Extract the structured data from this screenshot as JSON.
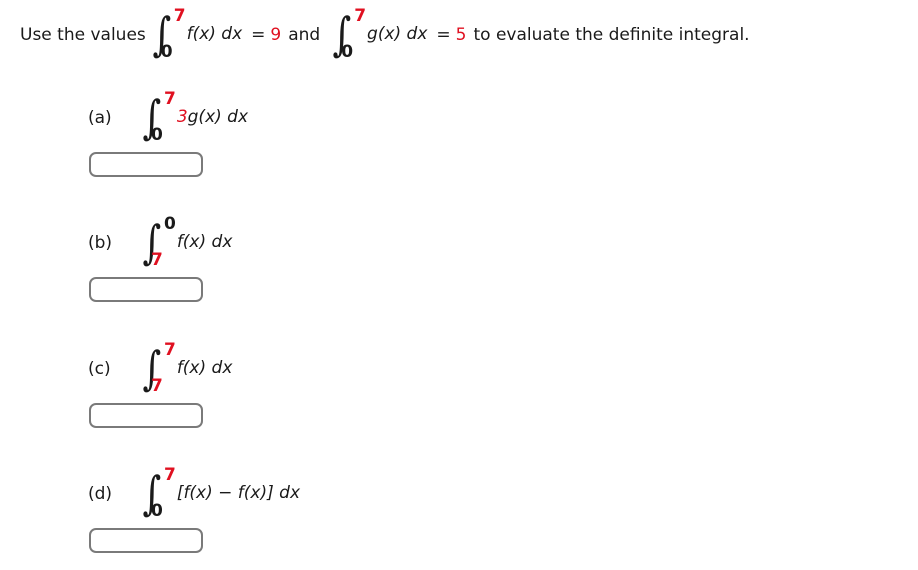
{
  "colors": {
    "accent_red": "#e01020",
    "text": "#1a1a1a",
    "box_border": "#7a7a7a",
    "background": "#ffffff"
  },
  "header": {
    "lead_text": "Use the values",
    "integral_1": {
      "upper": "7",
      "upper_color": "red",
      "lower": "0",
      "lower_color": "black",
      "integrand": "f(x) dx"
    },
    "equals_1": "=",
    "value_1": "9",
    "conjunction": "and",
    "integral_2": {
      "upper": "7",
      "upper_color": "red",
      "lower": "0",
      "lower_color": "black",
      "integrand": "g(x) dx"
    },
    "equals_2": "=",
    "value_2": "5",
    "trailing_text": "to evaluate the definite integral."
  },
  "parts": [
    {
      "label": "(a)",
      "upper": "7",
      "upper_color": "red",
      "lower": "0",
      "lower_color": "black",
      "coefficient": "3",
      "coefficient_color": "red",
      "integrand": "g(x) dx",
      "answer_value": "",
      "answer_placeholder": ""
    },
    {
      "label": "(b)",
      "upper": "0",
      "upper_color": "black",
      "lower": "7",
      "lower_color": "red",
      "coefficient": "",
      "coefficient_color": "red",
      "integrand": "f(x) dx",
      "answer_value": "",
      "answer_placeholder": ""
    },
    {
      "label": "(c)",
      "upper": "7",
      "upper_color": "red",
      "lower": "7",
      "lower_color": "red",
      "coefficient": "",
      "coefficient_color": "red",
      "integrand": "f(x) dx",
      "answer_value": "",
      "answer_placeholder": ""
    },
    {
      "label": "(d)",
      "upper": "7",
      "upper_color": "red",
      "lower": "0",
      "lower_color": "black",
      "coefficient": "",
      "coefficient_color": "red",
      "integrand": "[f(x) − f(x)] dx",
      "answer_value": "",
      "answer_placeholder": ""
    }
  ],
  "icons": {
    "integral_sign": "∫"
  }
}
